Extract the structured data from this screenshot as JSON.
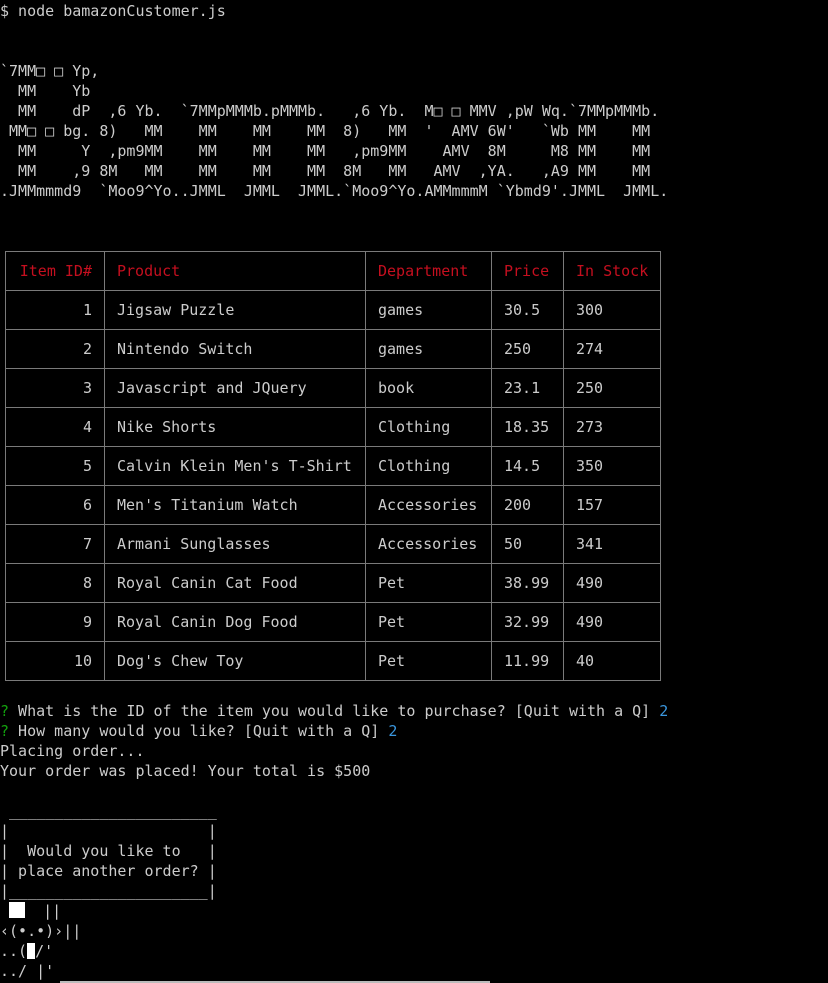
{
  "terminal": {
    "command": "$ node bamazonCustomer.js",
    "banner": [
      "`7MM□ □ Yp,",
      "  MM    Yb",
      "  MM    dP  ,6 Yb.  `7MMpMMMb.pMMMb.   ,6 Yb.  M□ □ MMV ,pW Wq.`7MMpMMMb.",
      " MM□ □ bg. 8)   MM    MM    MM    MM  8)   MM  '  AMV 6W'   `Wb MM    MM",
      "  MM     Y  ,pm9MM    MM    MM    MM   ,pm9MM    AMV  8M     M8 MM    MM",
      "  MM    ,9 8M   MM    MM    MM    MM  8M   MM   AMV  ,YA.   ,A9 MM    MM",
      ".JMMmmmd9  `Moo9^Yo..JMML  JMML  JMML.`Moo9^Yo.AMMmmmM `Ybmd9'.JMML  JMML."
    ]
  },
  "table": {
    "headers": [
      "Item ID#",
      "Product",
      "Department",
      "Price",
      "In Stock"
    ],
    "header_color": "#c50f1f",
    "rows": [
      {
        "id": "1",
        "product": "Jigsaw Puzzle",
        "department": "games",
        "price": "30.5",
        "stock": "300"
      },
      {
        "id": "2",
        "product": "Nintendo Switch",
        "department": "games",
        "price": "250",
        "stock": "274"
      },
      {
        "id": "3",
        "product": "Javascript and JQuery",
        "department": "book",
        "price": "23.1",
        "stock": "250"
      },
      {
        "id": "4",
        "product": "Nike Shorts",
        "department": "Clothing",
        "price": "18.35",
        "stock": "273"
      },
      {
        "id": "5",
        "product": "Calvin Klein Men's T-Shirt",
        "department": "Clothing",
        "price": "14.5",
        "stock": "350"
      },
      {
        "id": "6",
        "product": "Men's Titanium Watch",
        "department": "Accessories",
        "price": "200",
        "stock": "157"
      },
      {
        "id": "7",
        "product": "Armani Sunglasses",
        "department": "Accessories",
        "price": "50",
        "stock": "341"
      },
      {
        "id": "8",
        "product": "Royal Canin Cat Food",
        "department": "Pet",
        "price": "38.99",
        "stock": "490"
      },
      {
        "id": "9",
        "product": "Royal Canin Dog Food",
        "department": "Pet",
        "price": "32.99",
        "stock": "490"
      },
      {
        "id": "10",
        "product": "Dog's Chew Toy",
        "department": "Pet",
        "price": "11.99",
        "stock": "40"
      }
    ]
  },
  "prompts": {
    "q_mark": "?",
    "q1": " What is the ID of the item you would like to purchase? [Quit with a Q] ",
    "a1": "2",
    "q2": " How many would you like? [Quit with a Q] ",
    "a2": "2",
    "status": "Placing order...",
    "result": "Your order was placed! Your total is $500",
    "question_color": "#13a10e",
    "answer_color": "#3a96dd"
  },
  "dialog": {
    "box": " _______________________\n|                      |\n|  Would you like to   |\n| place another order? |\n|______________________|"
  },
  "mascot": {
    "l1a": " ",
    "l1b": "  ||",
    "l2": "‹(•.•)›||",
    "l3a": "..(",
    "l3b": "/'",
    "l4": "../ |'"
  }
}
